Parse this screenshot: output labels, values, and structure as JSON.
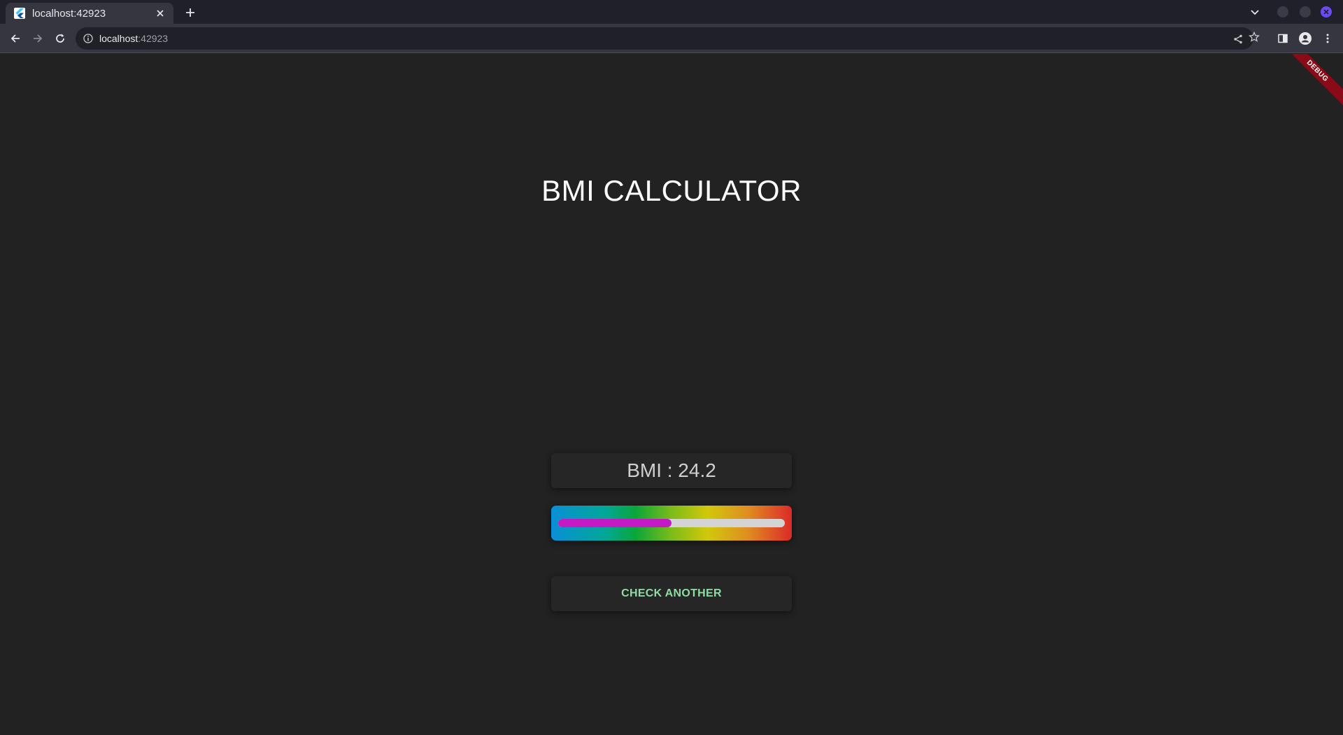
{
  "browser": {
    "tab": {
      "title": "localhost:42923",
      "favicon": "flutter-icon"
    },
    "address_bar": {
      "host": "localhost",
      "port": ":42923"
    },
    "icons": {
      "back": "back-arrow-icon",
      "forward": "forward-arrow-icon",
      "reload": "reload-icon",
      "info": "info-icon",
      "share": "share-icon",
      "bookmark": "star-icon",
      "side_panel": "side-panel-icon",
      "profile": "profile-icon",
      "menu": "kebab-menu-icon"
    }
  },
  "app": {
    "debug_banner": "DEBUG",
    "title": "BMI CALCULATOR",
    "result_text": "BMI : 24.2",
    "gauge": {
      "fraction": 0.5,
      "fill_color": "#c31ac6",
      "track_color": "#d4d4d4",
      "gradient_colors": [
        "#0a8fd6",
        "#0aa63a",
        "#d2c80a",
        "#dc2a28"
      ]
    },
    "button_label": "CHECK ANOTHER",
    "button_color": "#8fdca3"
  }
}
